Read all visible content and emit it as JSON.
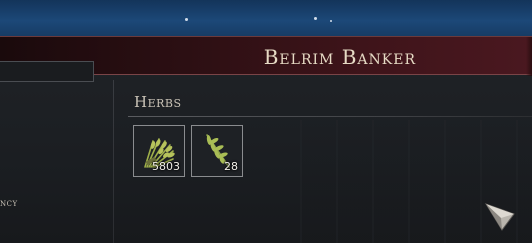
{
  "window": {
    "title": "Belrim Banker"
  },
  "left_panel": {
    "category_fragment": "ncy"
  },
  "category": {
    "name": "Herbs",
    "items": [
      {
        "name": "herb-bundle",
        "icon": "herb-bundle-icon",
        "count": "5803"
      },
      {
        "name": "herb-sprig",
        "icon": "herb-sprig-icon",
        "count": "28"
      }
    ]
  },
  "colors": {
    "title_bar": "#3f141a",
    "title_text": "#e6dac4",
    "slot_border": "#8a8c8f",
    "herb_green": "#9fb04a"
  }
}
